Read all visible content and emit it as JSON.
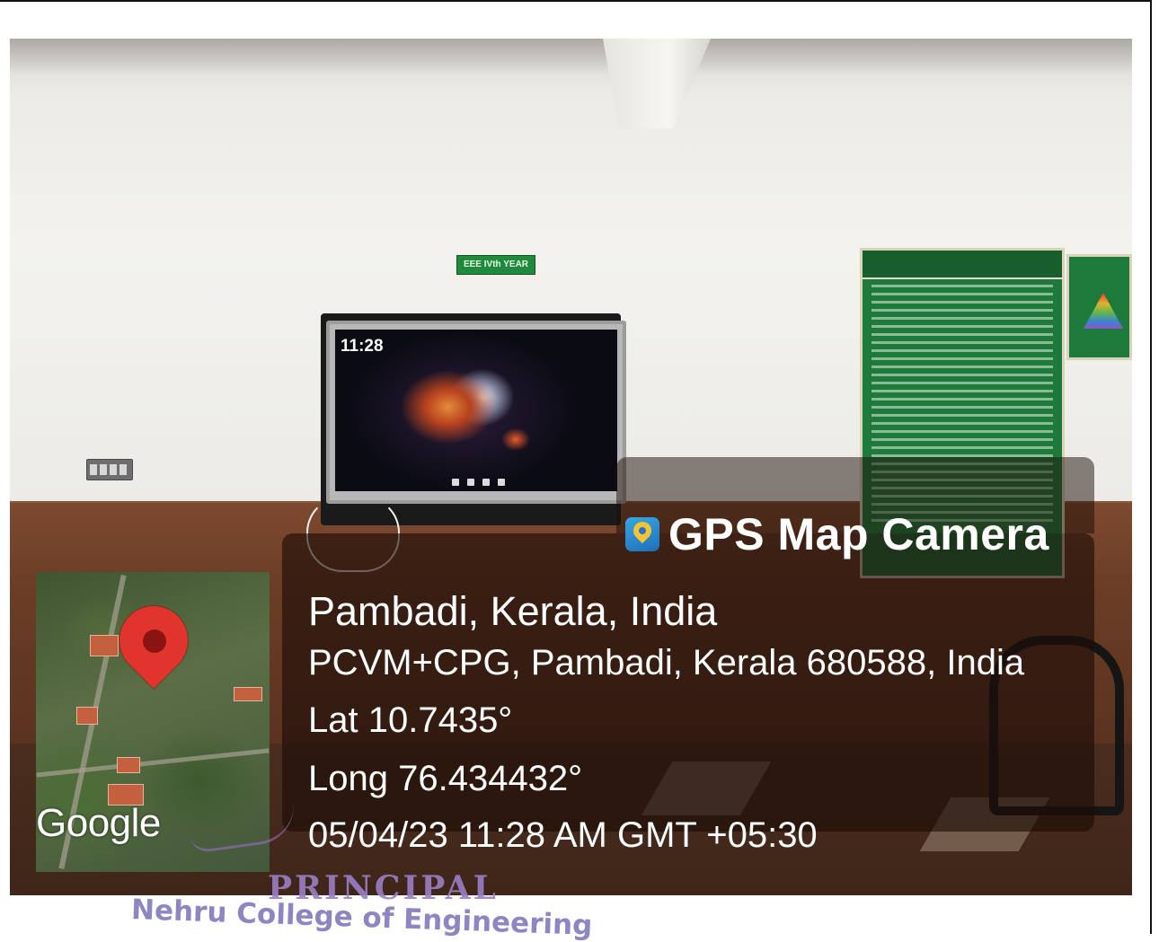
{
  "overlay": {
    "brand": "GPS Map Camera",
    "place": "Pambadi, Kerala, India",
    "address": "PCVM+CPG, Pambadi, Kerala 680588, India",
    "latitude": "Lat 10.7435°",
    "longitude": "Long 76.434432°",
    "datetime": "05/04/23 11:28 AM GMT +05:30"
  },
  "map_thumbnail": {
    "provider_logo": "Google",
    "pin_icon": "map-pin-icon",
    "pin_color": "#e0342c"
  },
  "scene": {
    "classroom_sign": "EEE IVth YEAR",
    "tv_clock": "11:28"
  },
  "stamp": {
    "title": "PRINCIPAL",
    "organization": "Nehru College of Engineering"
  },
  "colors": {
    "overlay_bg": "rgba(28,12,6,0.62)",
    "text": "#ffffff",
    "stamp_ink": "#8a78c0",
    "notice_board": "#1e7a3a"
  }
}
